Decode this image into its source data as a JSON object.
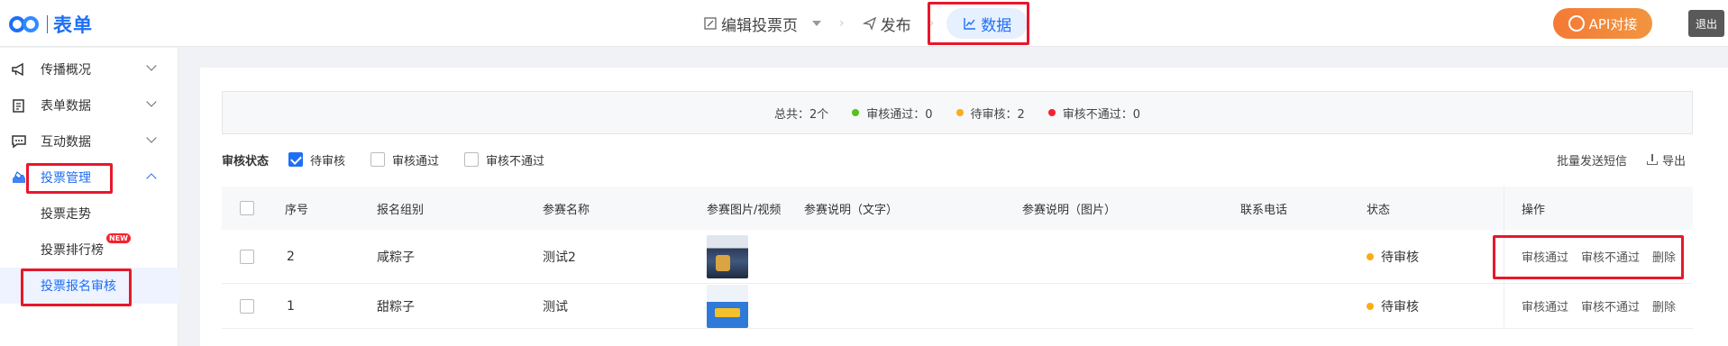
{
  "header": {
    "logo_text": "表单",
    "steps": [
      {
        "label": "编辑投票页",
        "icon": "edit-icon"
      },
      {
        "label": "发布",
        "icon": "send-icon"
      },
      {
        "label": "数据",
        "icon": "chart-line-icon"
      }
    ],
    "api_button": "API对接",
    "logout_button": "退出"
  },
  "sidebar": {
    "items": [
      {
        "label": "传播概况",
        "icon": "megaphone-icon"
      },
      {
        "label": "表单数据",
        "icon": "clipboard-icon"
      },
      {
        "label": "互动数据",
        "icon": "comment-icon"
      },
      {
        "label": "投票管理",
        "icon": "vote-icon"
      }
    ],
    "sub_items": [
      {
        "label": "投票走势"
      },
      {
        "label": "投票排行榜",
        "badge": "NEW"
      },
      {
        "label": "投票报名审核"
      }
    ]
  },
  "summary": {
    "total": "总共：2个",
    "approved": "审核通过：0",
    "pending": "待审核：2",
    "rejected": "审核不通过：0",
    "colors": {
      "approved": "#52c41a",
      "pending": "#faad14",
      "rejected": "#f5222d"
    }
  },
  "filter": {
    "title": "审核状态",
    "options": [
      {
        "label": "待审核",
        "checked": true
      },
      {
        "label": "审核通过",
        "checked": false
      },
      {
        "label": "审核不通过",
        "checked": false
      }
    ]
  },
  "toolbar": {
    "bulk_sms": "批量发送短信",
    "export": "导出"
  },
  "table": {
    "columns": [
      "序号",
      "报名组别",
      "参赛名称",
      "参赛图片/视频",
      "参赛说明（文字）",
      "参赛说明（图片）",
      "联系电话",
      "状态",
      "操作"
    ],
    "rows": [
      {
        "index": "2",
        "group": "咸粽子",
        "name": "测试2",
        "status": "待审核"
      },
      {
        "index": "1",
        "group": "甜粽子",
        "name": "测试",
        "status": "待审核"
      }
    ],
    "row_actions": [
      "审核通过",
      "审核不通过",
      "删除"
    ]
  },
  "colors": {
    "accent": "#1f6ff5",
    "highlight_box": "#e8172c"
  }
}
